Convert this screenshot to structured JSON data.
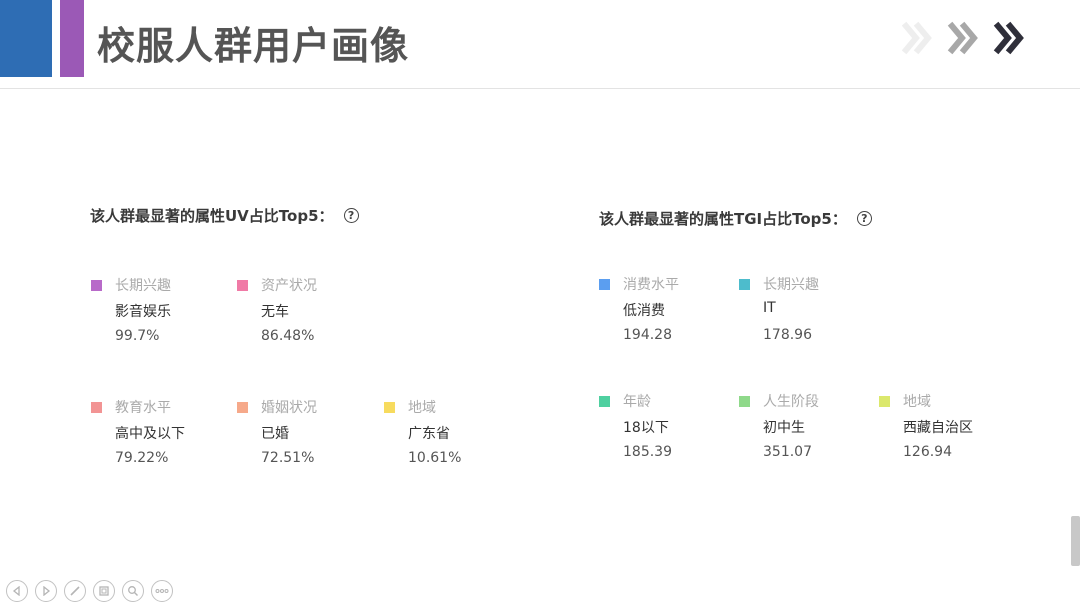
{
  "slide": {
    "title": "校服人群用户画像"
  },
  "uv_panel": {
    "title": "该人群最显著的属性UV占比Top5：",
    "items": [
      {
        "category": "长期兴趣",
        "value": "影音娱乐",
        "number": "99.7%",
        "color": "#b86ac9"
      },
      {
        "category": "资产状况",
        "value": "无车",
        "number": "86.48%",
        "color": "#f07aa6"
      },
      {
        "category": "教育水平",
        "value": "高中及以下",
        "number": "79.22%",
        "color": "#f29494"
      },
      {
        "category": "婚姻状况",
        "value": "已婚",
        "number": "72.51%",
        "color": "#f6a98a"
      },
      {
        "category": "地域",
        "value": "广东省",
        "number": "10.61%",
        "color": "#f7db5e"
      }
    ]
  },
  "tgi_panel": {
    "title": "该人群最显著的属性TGI占比Top5：",
    "items": [
      {
        "category": "消费水平",
        "value": "低消费",
        "number": "194.28",
        "color": "#5b9ef0"
      },
      {
        "category": "长期兴趣",
        "value": "IT",
        "number": "178.96",
        "color": "#4dbccc"
      },
      {
        "category": "年龄",
        "value": "18以下",
        "number": "185.39",
        "color": "#4fd0a0"
      },
      {
        "category": "人生阶段",
        "value": "初中生",
        "number": "351.07",
        "color": "#8fd98a"
      },
      {
        "category": "地域",
        "value": "西藏自治区",
        "number": "126.94",
        "color": "#dbe86c"
      }
    ]
  },
  "colors": {
    "accent_blue": "#2e6db4",
    "accent_purple": "#9b59b6"
  },
  "controls": {
    "icons": [
      "previous-icon",
      "next-icon",
      "pen-icon",
      "slides-icon",
      "zoom-icon",
      "more-icon"
    ]
  }
}
